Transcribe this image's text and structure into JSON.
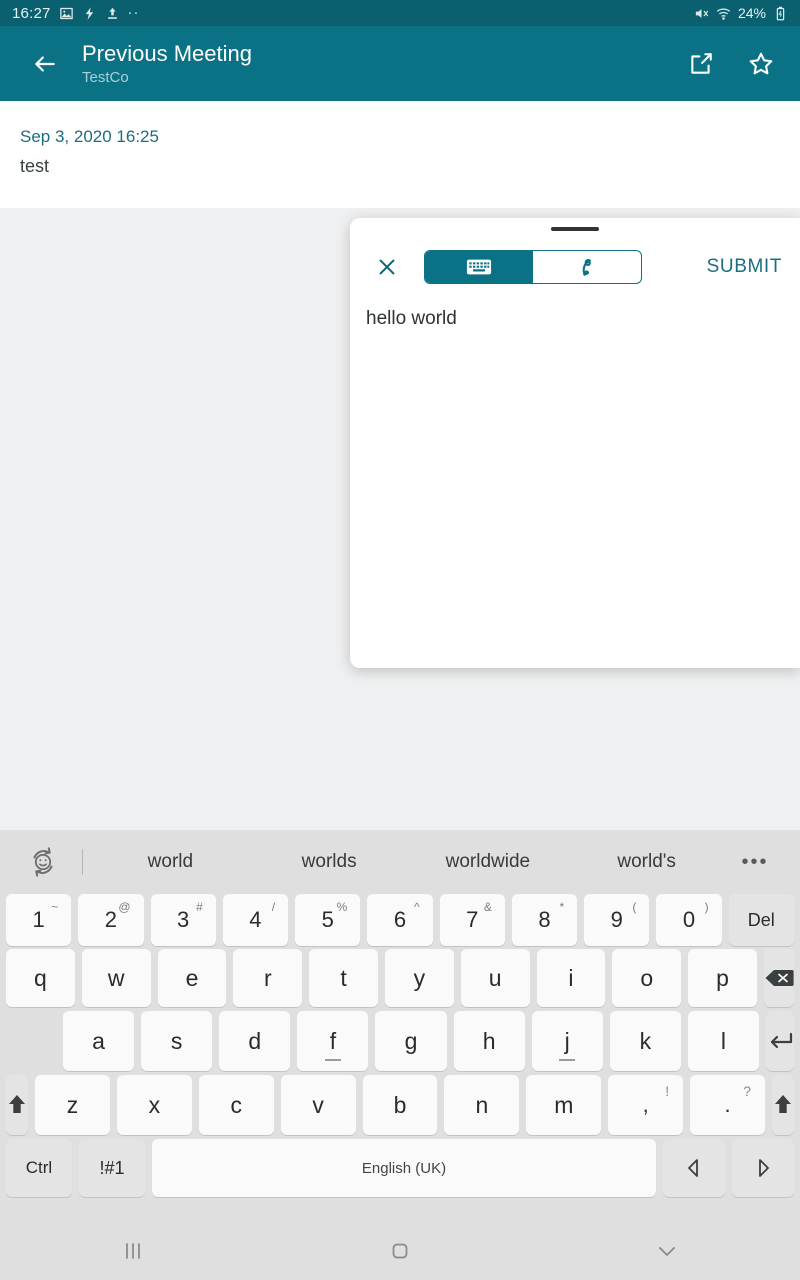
{
  "statusbar": {
    "time": "16:27",
    "battery_text": "24%",
    "icons": [
      "image-icon",
      "flash-icon",
      "upload-icon",
      "more-dots-icon"
    ],
    "right_icons": [
      "mute-icon",
      "wifi-icon",
      "battery-charging-icon"
    ]
  },
  "appbar": {
    "back_icon": "arrow-left-icon",
    "title": "Previous Meeting",
    "subtitle": "TestCo",
    "edit_icon": "edit-square-icon",
    "star_icon": "star-outline-icon"
  },
  "note": {
    "date": "Sep 3, 2020 16:25",
    "body": "test"
  },
  "panel": {
    "close_icon": "close-x-icon",
    "modes": [
      {
        "name": "keyboard-mode",
        "icon": "keyboard-icon",
        "selected": true
      },
      {
        "name": "handwriting-mode",
        "icon": "scribble-icon",
        "selected": false
      }
    ],
    "submit_label": "SUBMIT",
    "text_value": "hello world",
    "text_placeholder": ""
  },
  "keyboard": {
    "emoji_icon": "emoji-switch-icon",
    "suggestions": [
      "world",
      "worlds",
      "worldwide",
      "world's"
    ],
    "more_label": "•••",
    "number_row": [
      {
        "main": "1",
        "sup": "~"
      },
      {
        "main": "2",
        "sup": "@"
      },
      {
        "main": "3",
        "sup": "#"
      },
      {
        "main": "4",
        "sup": "/"
      },
      {
        "main": "5",
        "sup": "%"
      },
      {
        "main": "6",
        "sup": "^"
      },
      {
        "main": "7",
        "sup": "&"
      },
      {
        "main": "8",
        "sup": "*"
      },
      {
        "main": "9",
        "sup": "("
      },
      {
        "main": "0",
        "sup": ")"
      }
    ],
    "delete_label": "Del",
    "row_q": [
      "q",
      "w",
      "e",
      "r",
      "t",
      "y",
      "u",
      "i",
      "o",
      "p"
    ],
    "backspace_icon": "backspace-icon",
    "row_a": [
      "a",
      "s",
      "d",
      "f",
      "g",
      "h",
      "j",
      "k",
      "l"
    ],
    "enter_icon": "enter-icon",
    "row_z": [
      "z",
      "x",
      "c",
      "v",
      "b",
      "n",
      "m"
    ],
    "shift_icon": "shift-icon",
    "comma": {
      "main": ",",
      "sup": "!"
    },
    "period": {
      "main": ".",
      "sup": "?"
    },
    "ctrl_label": "Ctrl",
    "symbols_label": "!#1",
    "space_label": "English (UK)",
    "arrow_left_icon": "caret-left-icon",
    "arrow_right_icon": "caret-right-icon"
  },
  "navbar": {
    "recents_icon": "recents-icon",
    "home_icon": "home-icon",
    "hide_keyboard_icon": "chevron-down-icon"
  },
  "colors": {
    "accent": "#0b7285",
    "statusbar": "#0b6070",
    "link": "#1a6e80",
    "content_bg": "#eff0f1",
    "keyboard_bg": "#dfdfdf"
  }
}
